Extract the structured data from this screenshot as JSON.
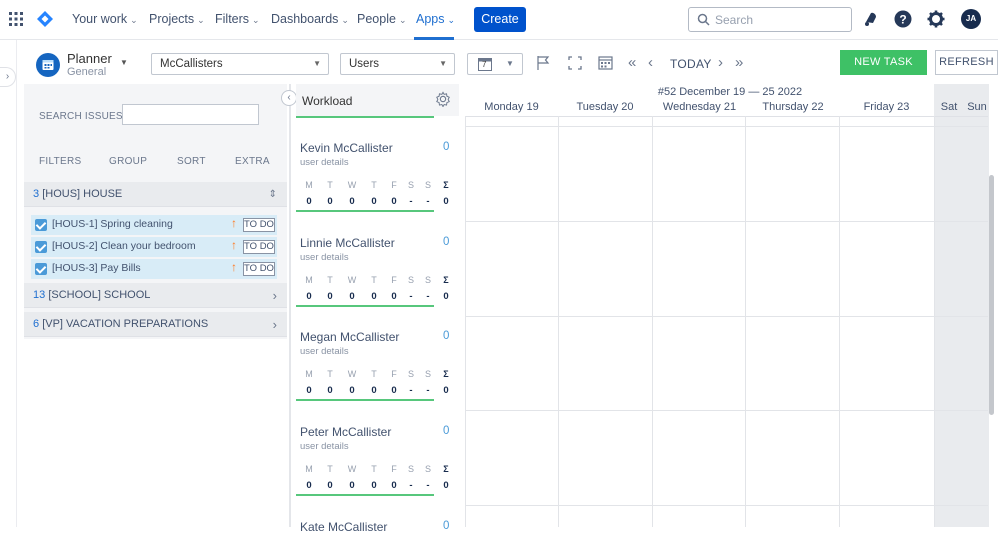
{
  "topnav": {
    "items": [
      {
        "label": "Your work"
      },
      {
        "label": "Projects"
      },
      {
        "label": "Filters"
      },
      {
        "label": "Dashboards"
      },
      {
        "label": "People"
      },
      {
        "label": "Apps"
      }
    ],
    "create_label": "Create",
    "search_placeholder": "Search",
    "avatar_initials": "JA",
    "accent_color": "#0052cc"
  },
  "toolbar": {
    "planner_title": "Planner",
    "planner_subtitle": "General",
    "team_select": "McCallisters",
    "view_select": "Users",
    "calendar_day": "7",
    "today_label": "TODAY",
    "new_task_label": "NEW TASK",
    "refresh_label": "REFRESH"
  },
  "issues": {
    "search_label": "SEARCH ISSUES:",
    "tabs": [
      "FILTERS",
      "GROUP",
      "SORT",
      "EXTRA"
    ],
    "groups": [
      {
        "count": "3",
        "name": "[HOUS] HOUSE"
      },
      {
        "count": "13",
        "name": "[SCHOOL] SCHOOL"
      },
      {
        "count": "6",
        "name": "[VP] VACATION PREPARATIONS"
      }
    ],
    "items": [
      {
        "key": "[HOUS-1] Spring cleaning",
        "status": "TO DO"
      },
      {
        "key": "[HOUS-2] Clean your bedroom",
        "status": "TO DO"
      },
      {
        "key": "[HOUS-3] Pay Bills",
        "status": "TO DO"
      }
    ]
  },
  "workload": {
    "title": "Workload",
    "day_letters": [
      "M",
      "T",
      "W",
      "T",
      "F",
      "S",
      "S",
      "Σ"
    ],
    "people": [
      {
        "name": "Kevin McCallister",
        "details": "user details",
        "count": "0",
        "values": [
          "0",
          "0",
          "0",
          "0",
          "0",
          "-",
          "-",
          "0"
        ]
      },
      {
        "name": "Linnie McCallister",
        "details": "user details",
        "count": "0",
        "values": [
          "0",
          "0",
          "0",
          "0",
          "0",
          "-",
          "-",
          "0"
        ]
      },
      {
        "name": "Megan McCallister",
        "details": "user details",
        "count": "0",
        "values": [
          "0",
          "0",
          "0",
          "0",
          "0",
          "-",
          "-",
          "0"
        ]
      },
      {
        "name": "Peter McCallister",
        "details": "user details",
        "count": "0",
        "values": [
          "0",
          "0",
          "0",
          "0",
          "0",
          "-",
          "-",
          "0"
        ]
      },
      {
        "name": "Kate McCallister",
        "details": "",
        "count": "0",
        "values": []
      }
    ]
  },
  "calendar": {
    "week_label": "#52 December 19 — 25 2022",
    "days": [
      "Monday 19",
      "Tuesday 20",
      "Wednesday 21",
      "Thursday 22",
      "Friday 23",
      "Sat",
      "Sun"
    ]
  }
}
